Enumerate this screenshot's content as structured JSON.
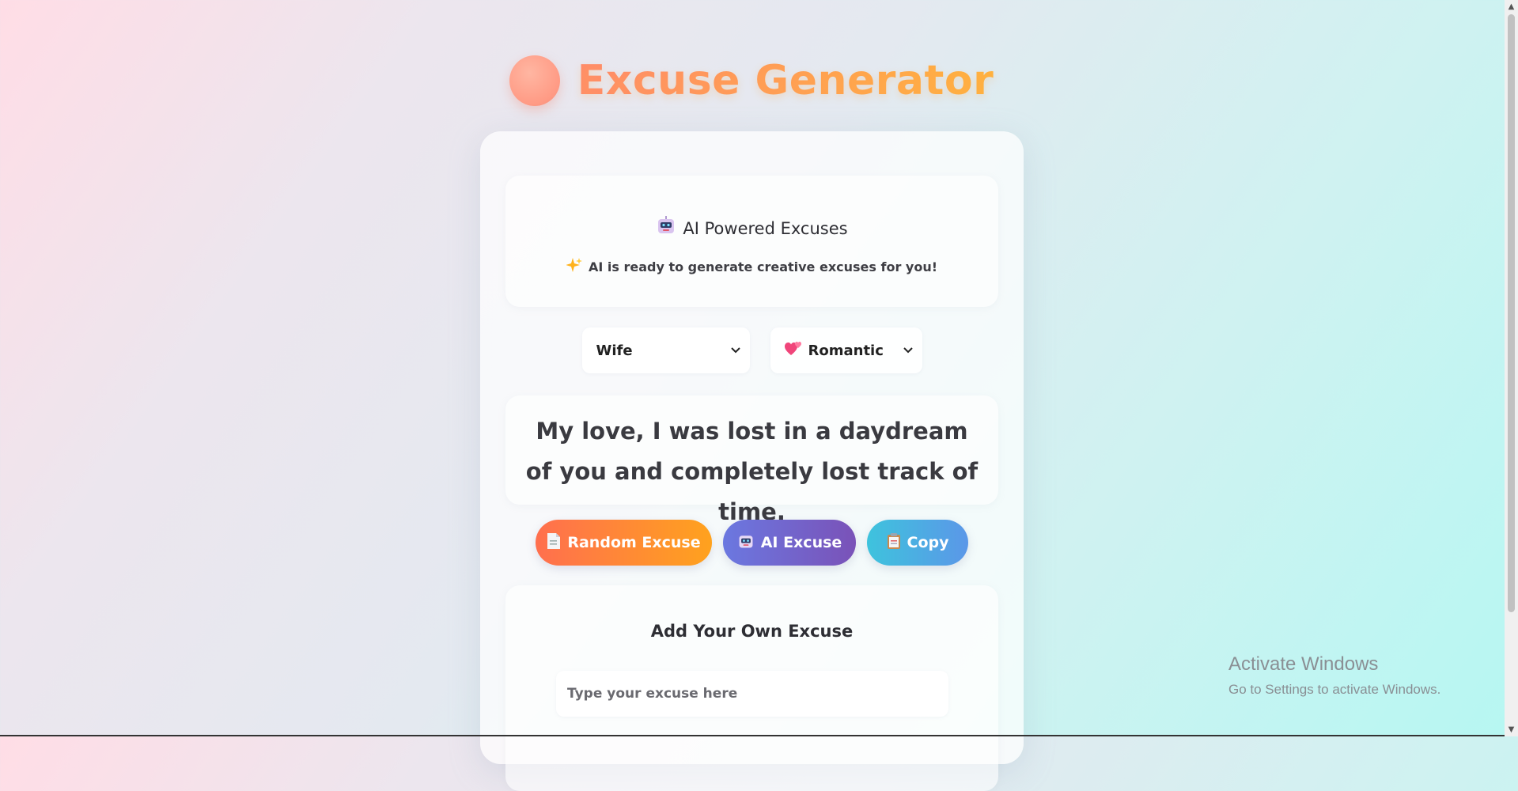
{
  "header": {
    "emoji_icon": "blushing-face-icon",
    "title": "Excuse Generator"
  },
  "ai_panel": {
    "icon": "robot-icon",
    "heading": "AI Powered Excuses",
    "status_icon": "sparkles-icon",
    "status": "AI is ready to generate creative excuses for you!"
  },
  "recipient_select": {
    "selected": "Wife"
  },
  "mood_select": {
    "icon": "two-hearts-icon",
    "selected": "Romantic"
  },
  "excuse": {
    "text": "My love, I was lost in a daydream of you and completely lost track of time."
  },
  "buttons": {
    "random": {
      "icon": "page-icon",
      "label": "Random Excuse"
    },
    "ai": {
      "icon": "robot-icon",
      "label": "AI Excuse"
    },
    "copy": {
      "icon": "clipboard-icon",
      "label": "Copy"
    }
  },
  "add_panel": {
    "heading": "Add Your Own Excuse",
    "placeholder": "Type your excuse here"
  },
  "watermark": {
    "title": "Activate Windows",
    "subtitle": "Go to Settings to activate Windows."
  },
  "colors": {
    "title_gradient": [
      "#ff8a6b",
      "#ffb23e"
    ],
    "random_button": [
      "#ff6f4e",
      "#ffa21e"
    ],
    "ai_button": [
      "#6b78e0",
      "#7a52b8"
    ],
    "copy_button": [
      "#3ec3dd",
      "#5b97e8"
    ]
  }
}
